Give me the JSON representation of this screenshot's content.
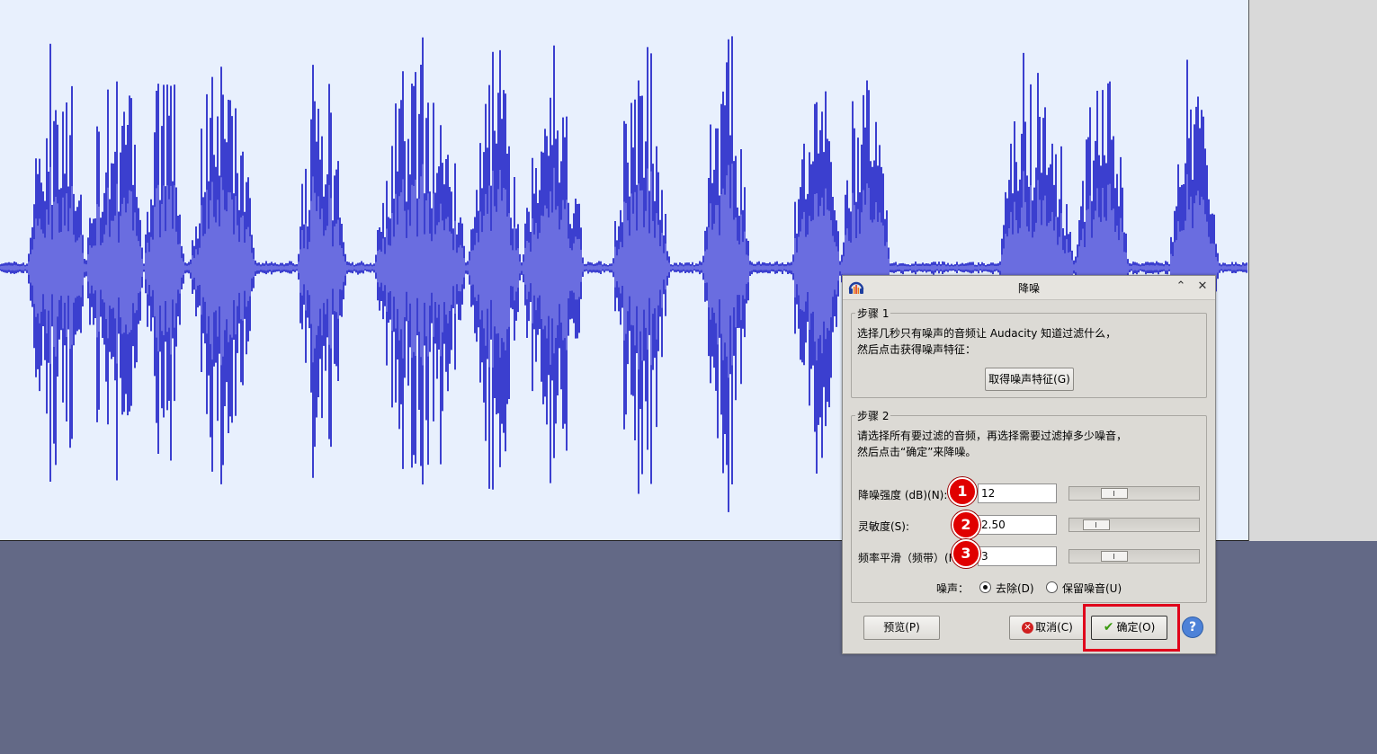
{
  "dialog": {
    "title": "降噪",
    "step1": {
      "title": "步骤 1",
      "line1": "选择几秒只有噪声的音频让 Audacity 知道过滤什么，",
      "line2": "然后点击获得噪声特征：",
      "button": "取得噪声特征(G)"
    },
    "step2": {
      "title": "步骤 2",
      "line1": "请选择所有要过滤的音频，再选择需要过滤掉多少噪音，",
      "line2": "然后点击“确定”来降噪。",
      "params": [
        {
          "label": "降噪强度 (dB)(N):",
          "value": "12",
          "slider_fraction": 0.3,
          "badge": "1"
        },
        {
          "label": "灵敏度(S):",
          "value": "2.50",
          "slider_fraction": 0.13,
          "badge": "2"
        },
        {
          "label": "频率平滑（频带）(F):",
          "value": "3",
          "slider_fraction": 0.3,
          "badge": "3"
        }
      ],
      "noise_label": "噪声：",
      "option_remove": "去除(D)",
      "option_keep": "保留噪音(U)",
      "selected_option": "去除(D)"
    },
    "buttons": {
      "preview": "预览(P)",
      "cancel": "取消(C)",
      "ok": "确定(O)",
      "help": "?"
    }
  },
  "colors": {
    "waveform": "#3b3fcf",
    "waveform_rms": "#6a6de0",
    "track_background": "#e8f0fd",
    "workspace": "#636986",
    "highlight": "#e0001b",
    "badge": "#e00000"
  },
  "icons": [
    "audacity-icon",
    "minimize-icon",
    "close-icon",
    "cancel-icon",
    "checkmark-icon",
    "help-icon"
  ]
}
